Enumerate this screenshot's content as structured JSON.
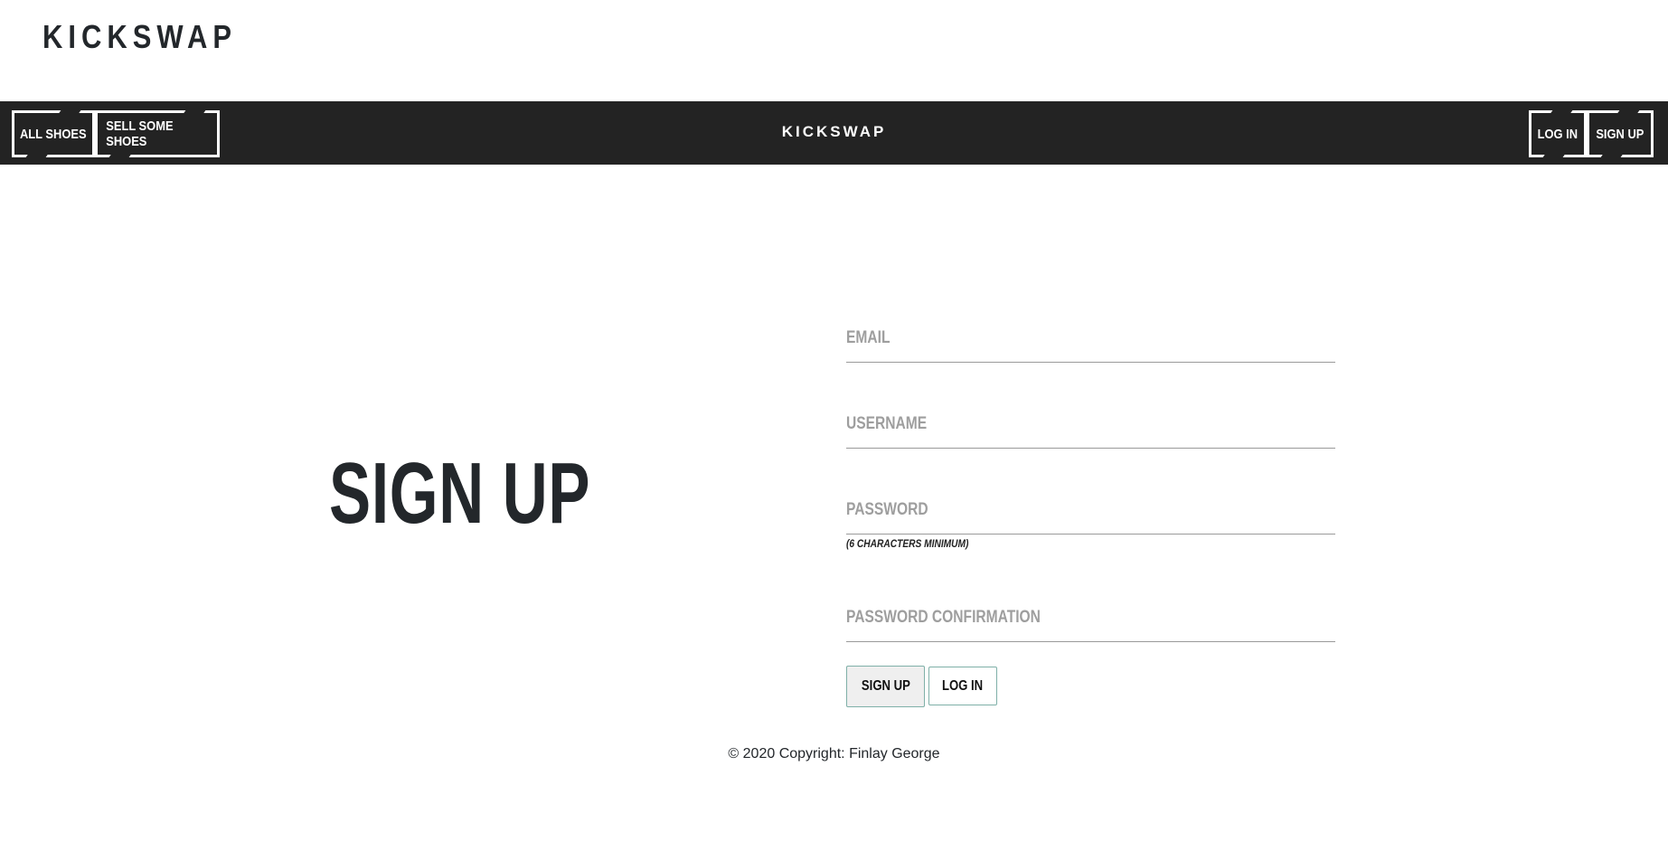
{
  "brand": {
    "top_title": "KICKSWAP",
    "nav_title": "KICKSWAP"
  },
  "nav": {
    "all_shoes": "ALL SHOES",
    "sell_shoes": "SELL SOME SHOES",
    "log_in": "LOG IN",
    "sign_up": "SIGN UP"
  },
  "main": {
    "heading": "SIGN UP"
  },
  "form": {
    "email_placeholder": "EMAIL",
    "username_placeholder": "USERNAME",
    "password_placeholder": "PASSWORD",
    "password_hint": "(6 CHARACTERS MINIMUM)",
    "password_confirmation_placeholder": "PASSWORD CONFIRMATION",
    "submit_label": "SIGN UP",
    "login_label": "LOG IN"
  },
  "footer": {
    "copyright": "© 2020 Copyright: Finlay George"
  },
  "colors": {
    "navbar_bg": "#232323",
    "text_dark": "#23272b",
    "placeholder": "#9e9e9e",
    "button_border": "#7fb0a8"
  }
}
